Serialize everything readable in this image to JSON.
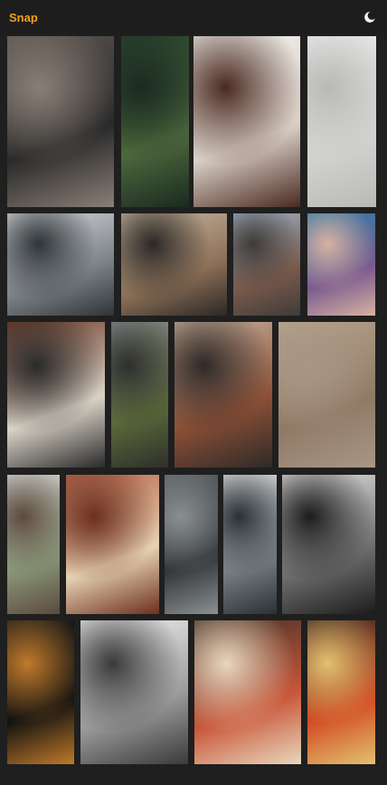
{
  "app": {
    "brand": "Snap"
  },
  "header": {
    "theme_icon": "moon-icon"
  },
  "gallery": {
    "photos": [
      {
        "name": "photo-laptop-on-rug",
        "colors": [
          "#5b544f",
          "#2a2a2a",
          "#8a7f76"
        ]
      },
      {
        "name": "photo-winding-forest-road",
        "colors": [
          "#27412e",
          "#4f6a3e",
          "#1b2a20"
        ]
      },
      {
        "name": "photo-woman-with-flowers",
        "colors": [
          "#f1efec",
          "#d9cfc6",
          "#4a2a22"
        ]
      },
      {
        "name": "photo-white-desk-laptop",
        "colors": [
          "#ececec",
          "#d4d4d2",
          "#b9b9b6"
        ]
      },
      {
        "name": "photo-city-through-fence",
        "colors": [
          "#d8dbdd",
          "#7c8186",
          "#2f3438"
        ]
      },
      {
        "name": "photo-camera-hands",
        "colors": [
          "#c9b8a2",
          "#8c6f57",
          "#2b2826"
        ]
      },
      {
        "name": "photo-harbor-house",
        "colors": [
          "#9fb3c8",
          "#7a5b4c",
          "#3f3b39"
        ]
      },
      {
        "name": "photo-abstract-paint-waves",
        "colors": [
          "#2c7ea8",
          "#7a5b8f",
          "#d8b1a1"
        ]
      },
      {
        "name": "photo-laptop-coding-desk",
        "colors": [
          "#6b3a25",
          "#d9d2c6",
          "#2a2a2a"
        ]
      },
      {
        "name": "photo-mountain-valley",
        "colors": [
          "#8a8e8f",
          "#5c6b3a",
          "#2e2f2c"
        ]
      },
      {
        "name": "photo-flatiron-building",
        "colors": [
          "#c7b3a0",
          "#8b4f36",
          "#2f2a28"
        ]
      },
      {
        "name": "photo-desert-texture",
        "colors": [
          "#b7a48e",
          "#8f7a66",
          "#a89784"
        ]
      },
      {
        "name": "photo-woman-waving",
        "colors": [
          "#d9d9d9",
          "#8b9b7a",
          "#5c4a3e"
        ]
      },
      {
        "name": "photo-red-canyon",
        "colors": [
          "#b5654a",
          "#e6d1b3",
          "#6b2f1e"
        ]
      },
      {
        "name": "photo-ocean-waves-bw",
        "colors": [
          "#5a5f62",
          "#2f3336",
          "#8a8f92"
        ]
      },
      {
        "name": "photo-tower-bridge",
        "colors": [
          "#e4e6e8",
          "#7b8388",
          "#2b3034"
        ]
      },
      {
        "name": "photo-bowery-street-bw",
        "colors": [
          "#e5e5e5",
          "#6d6d6d",
          "#1c1c1c"
        ]
      },
      {
        "name": "photo-night-building",
        "colors": [
          "#1b1b1b",
          "#0f0f0f",
          "#c07a2a"
        ]
      },
      {
        "name": "photo-building-looking-up",
        "colors": [
          "#f2f2f2",
          "#9a9a9a",
          "#3a3a3a"
        ]
      },
      {
        "name": "photo-pizza-table",
        "colors": [
          "#3e2e24",
          "#c9573a",
          "#e8d7bd"
        ]
      },
      {
        "name": "photo-tomato-soup",
        "colors": [
          "#3b2a22",
          "#d14a22",
          "#e3c16f"
        ]
      }
    ]
  }
}
